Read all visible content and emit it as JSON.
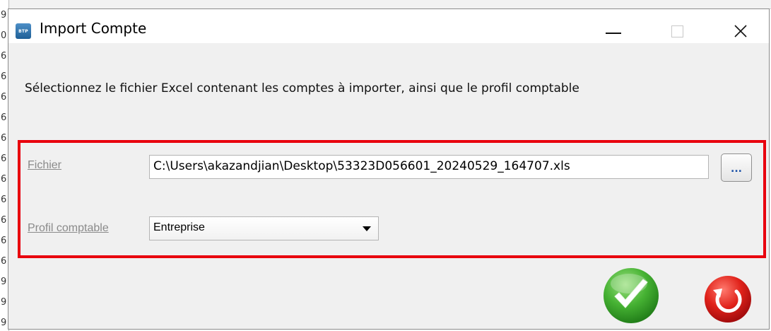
{
  "background": {
    "left_digits": [
      "9",
      "0",
      "6",
      "6",
      "6",
      "6",
      "6",
      "6",
      "6",
      "6",
      "6",
      "6",
      "6",
      "9",
      "9",
      "9"
    ]
  },
  "window": {
    "title": "Import Compte",
    "icon_text": "BTP",
    "minimize_icon": "minimize-icon",
    "maximize_icon": "maximize-icon",
    "close_icon": "close-icon"
  },
  "instruction": "Sélectionnez le fichier Excel contenant les comptes à importer, ainsi que le profil comptable",
  "form": {
    "file_label": "Fichier",
    "file_value": "C:\\Users\\akazandjian\\Desktop\\53323D056601_20240529_164707.xls",
    "browse_label": "...",
    "profile_label": "Profil comptable",
    "profile_value": "Entreprise"
  },
  "actions": {
    "ok_icon": "checkmark-icon",
    "cancel_icon": "undo-icon"
  },
  "colors": {
    "highlight_border": "#e8000d",
    "ok_green": "#3aa52d",
    "cancel_red": "#d4141b"
  }
}
